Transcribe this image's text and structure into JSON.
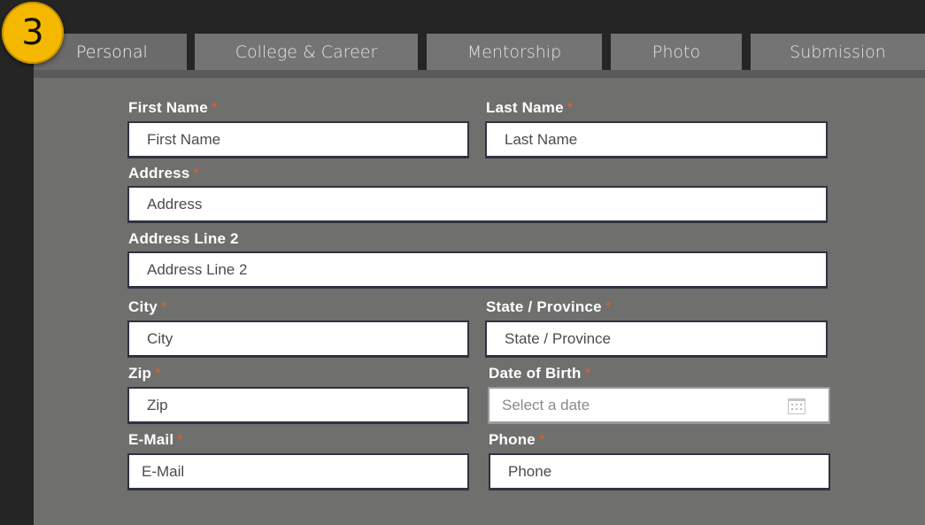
{
  "step_badge": "3",
  "tabs": [
    {
      "label": "Personal",
      "active": true
    },
    {
      "label": "College & Career",
      "active": false
    },
    {
      "label": "Mentorship",
      "active": false
    },
    {
      "label": "Photo",
      "active": false
    },
    {
      "label": "Submission",
      "active": false
    }
  ],
  "required_marker": "*",
  "form": {
    "first_name": {
      "label": "First Name",
      "placeholder": "First Name"
    },
    "last_name": {
      "label": "Last Name",
      "placeholder": "Last Name"
    },
    "address": {
      "label": "Address",
      "placeholder": "Address"
    },
    "address_line_2": {
      "label": "Address Line 2",
      "placeholder": "Address Line 2"
    },
    "city": {
      "label": "City",
      "placeholder": "City"
    },
    "state": {
      "label": "State / Province",
      "placeholder": "State / Province"
    },
    "zip": {
      "label": "Zip",
      "placeholder": "Zip"
    },
    "dob": {
      "label": "Date of Birth",
      "placeholder": "Select a date",
      "icon": "calendar-icon"
    },
    "email": {
      "label": "E-Mail",
      "placeholder": "E-Mail"
    },
    "phone": {
      "label": "Phone",
      "placeholder": "Phone"
    }
  },
  "colors": {
    "accent_badge": "#f5b800",
    "required_marker": "#e0622a",
    "panel": "#6f6f6e",
    "tab": "#747474"
  }
}
